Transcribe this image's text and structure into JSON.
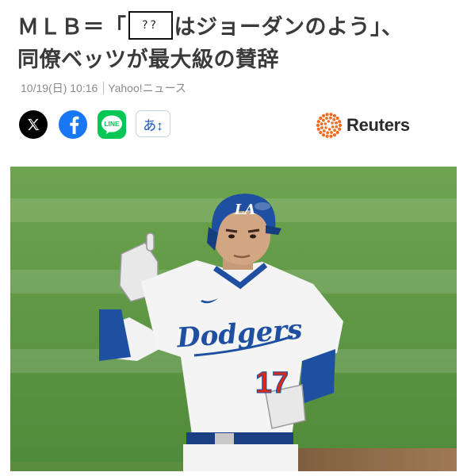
{
  "headline": {
    "line1_prefix": "ＭＬＢ＝「",
    "placeholder_text": "??",
    "line1_suffix": "はジョーダンのよう」、",
    "line2": "同僚ベッツが最大級の賛辞"
  },
  "meta": {
    "datetime": "10/19(日) 10:16",
    "source": "Yahoo!ニュース"
  },
  "share": {
    "x_icon": "x-logo-icon",
    "facebook_icon": "facebook-logo-icon",
    "line_icon": "line-logo-icon",
    "line_label": "LINE",
    "font_size_label": "あ↕"
  },
  "publisher": {
    "name": "Reuters",
    "icon": "reuters-dots-logo-icon",
    "color": "#f26c21"
  },
  "photo": {
    "jersey_text": "Dodgers",
    "jersey_number": "17",
    "cap_logo": "LA",
    "colors": {
      "field": "#5f9a45",
      "dodger_blue": "#1e4fa0",
      "number_red": "#d52b1e"
    }
  }
}
